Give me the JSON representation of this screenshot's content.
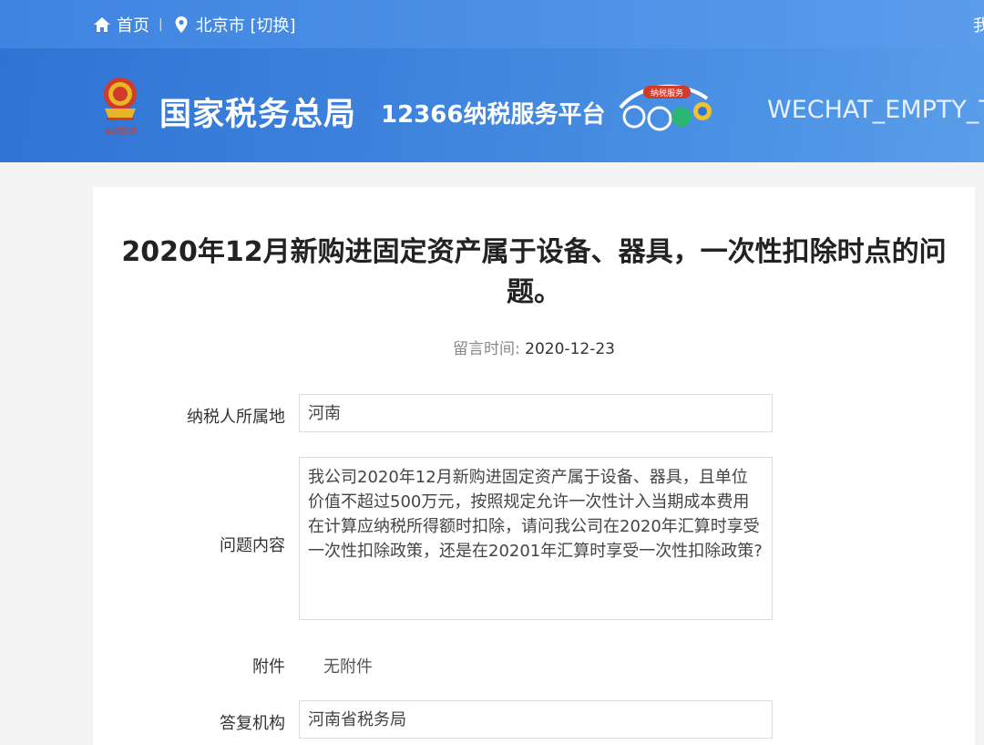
{
  "topbar": {
    "home_label": "首页",
    "separator": "|",
    "city_label": "北京市 [切换]",
    "right_text": "我"
  },
  "banner": {
    "agency_name": "国家税务总局",
    "platform_name": "12366纳税服务平台",
    "placeholder_text": "WECHAT_EMPTY_T",
    "emblem_caption": "中国税务",
    "logo_badge": "纳税服务"
  },
  "article": {
    "title": "2020年12月新购进固定资产属于设备、器具，一次性扣除时点的问题。",
    "time_label": "留言时间:",
    "time_value": "2020-12-23"
  },
  "form": {
    "location_label": "纳税人所属地",
    "location_value": "河南",
    "question_label": "问题内容",
    "question_value": "我公司2020年12月新购进固定资产属于设备、器具，且单位价值不超过500万元，按照规定允许一次性计入当期成本费用在计算应纳税所得额时扣除，请问我公司在2020年汇算时享受一次性扣除政策，还是在20201年汇算时享受一次性扣除政策?",
    "attachment_label": "附件",
    "attachment_value": "无附件",
    "agency_label": "答复机构",
    "agency_value": "河南省税务局"
  },
  "colors": {
    "header_blue": "#3f84e0",
    "banner_blue": "#2f74d4"
  }
}
